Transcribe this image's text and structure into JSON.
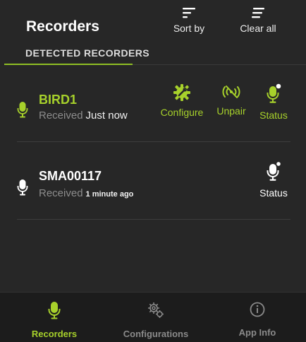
{
  "header": {
    "title": "Recorders",
    "sort_label": "Sort by",
    "clear_label": "Clear all"
  },
  "section": {
    "label": "DETECTED RECORDERS"
  },
  "recorders": [
    {
      "name": "BIRD1",
      "received_label": "Received",
      "received_when": "Just now",
      "actions": {
        "configure": "Configure",
        "unpair": "Unpair",
        "status": "Status"
      }
    },
    {
      "name": "SMA00117",
      "received_label": "Received",
      "received_when": "1 minute ago",
      "actions": {
        "status": "Status"
      }
    }
  ],
  "bottom_nav": {
    "recorders": "Recorders",
    "configurations": "Configurations",
    "app_info": "App Info"
  },
  "colors": {
    "accent": "#a7d12b",
    "background": "#272727",
    "nav_background": "#1c1c1c",
    "muted": "#8c8c8c"
  },
  "icons": {
    "sort": "sort-lines-icon",
    "clear": "clear-lines-icon",
    "mic": "microphone-icon",
    "configure": "gear-wrench-icon",
    "unpair": "broken-signal-icon",
    "status": "microphone-status-icon",
    "configurations": "gears-icon",
    "info": "info-circle-icon"
  }
}
